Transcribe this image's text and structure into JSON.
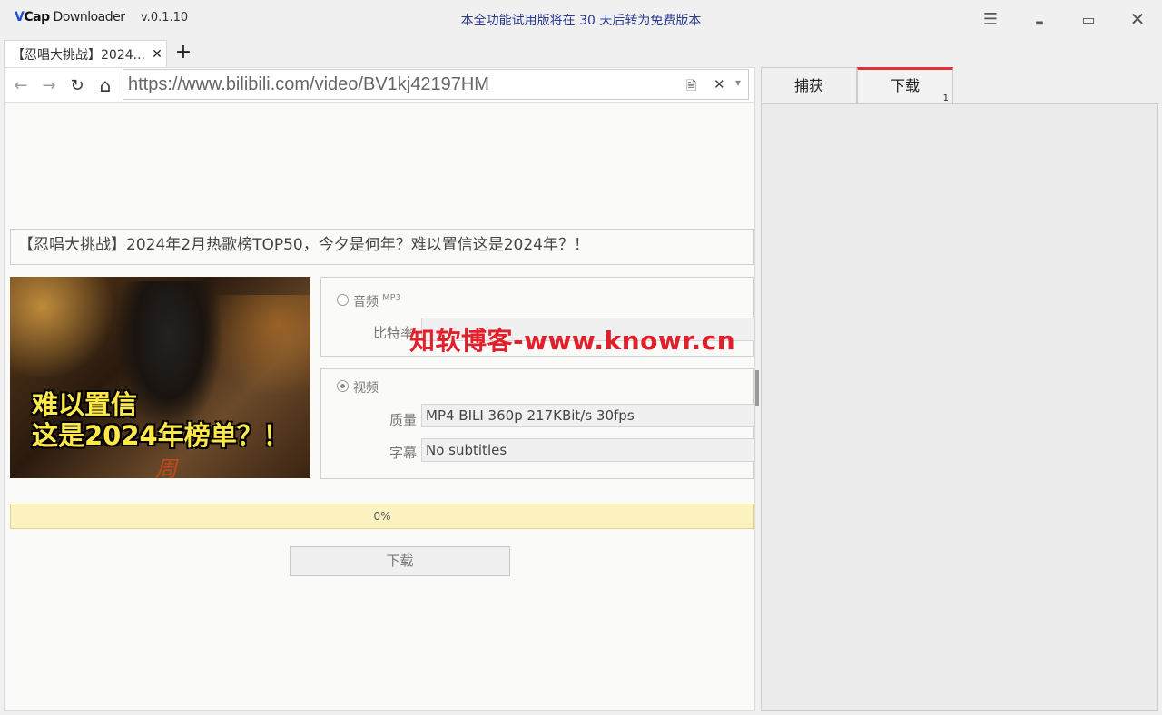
{
  "app": {
    "logo_v": "V",
    "logo_cap": "Cap",
    "logo_name": " Downloader",
    "version": "v.0.1.10",
    "trial_notice": "本全功能试用版将在 30 天后转为免费版本"
  },
  "window_controls": {
    "menu": "☰",
    "minimize": "▬",
    "maximize": "▭",
    "close": "✕"
  },
  "tabs": [
    {
      "title": "【忍唱大挑战】2024...",
      "close": "✕"
    }
  ],
  "new_tab": "+",
  "nav": {
    "back": "←",
    "forward": "→",
    "reload": "↻",
    "home": "⌂",
    "url": "https://www.bilibili.com/video/BV1kj42197HM",
    "page_icon": "🗎",
    "clear": "✕",
    "dropdown": "▾"
  },
  "video": {
    "title": "【忍唱大挑战】2024年2月热歌榜TOP50，今夕是何年？难以置信这是2024年？！",
    "thumbnail_caption_1": "难以置信",
    "thumbnail_caption_2": "这是2024年榜单？！",
    "thumbnail_signature": "周"
  },
  "audio": {
    "label": "音频",
    "format": "MP3",
    "bitrate_label": "比特率",
    "bitrate_value": "",
    "selected": false
  },
  "video_opts": {
    "label": "视频",
    "quality_label": "质量",
    "quality_value": "MP4 BILI 360p 217KBit/s 30fps",
    "subtitle_label": "字幕",
    "subtitle_value": "No subtitles",
    "selected": true
  },
  "watermark": "知软博客-www.knowr.cn",
  "progress": {
    "text": "0%",
    "value": 0
  },
  "download_button": "下载",
  "right_tabs": [
    {
      "label": "捕获"
    },
    {
      "label": "下载",
      "badge": "1"
    }
  ]
}
